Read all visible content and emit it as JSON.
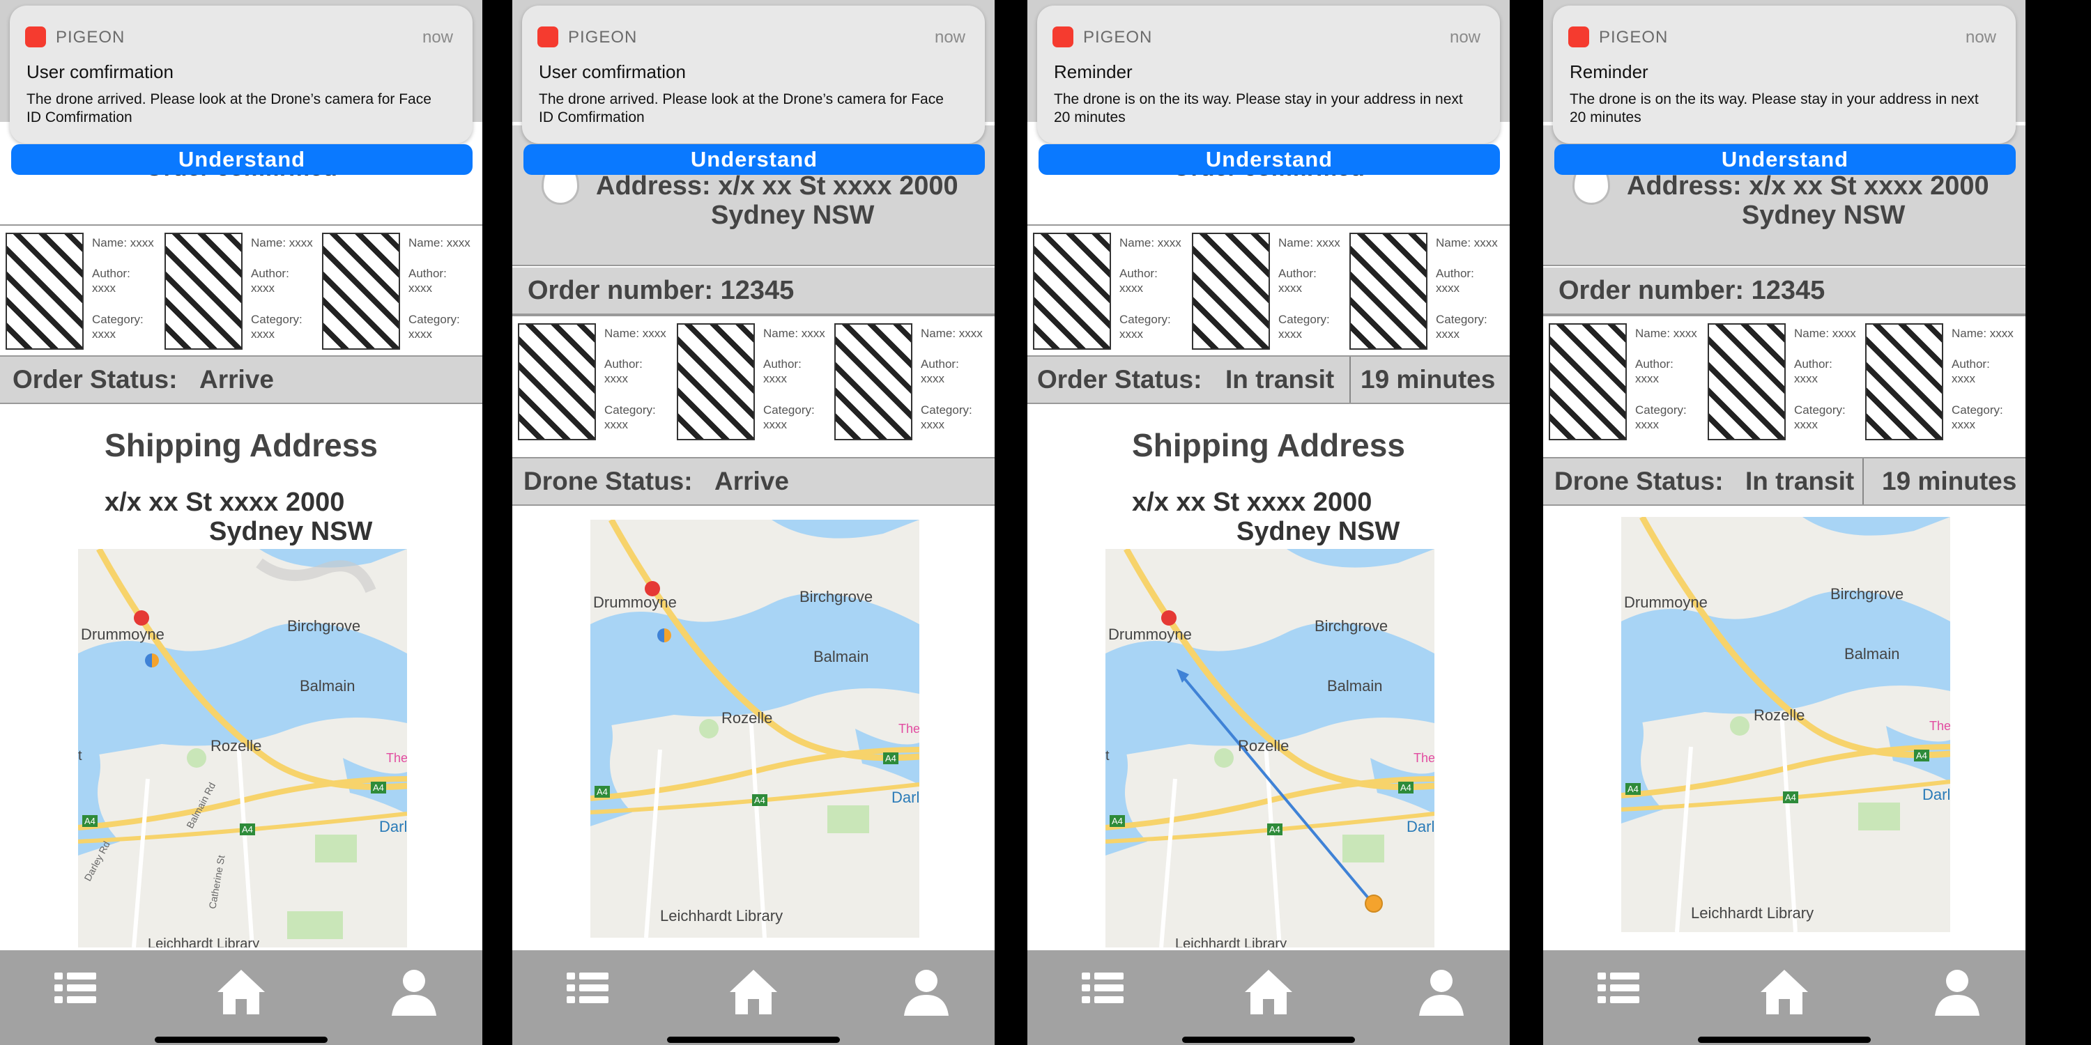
{
  "screens": [
    {
      "notification": {
        "app": "PIGEON",
        "time": "now",
        "title": "User comfirmation",
        "body": "The drone arrived. Please look at the Drone’s camera for Face ID Comfirmation",
        "button": "Understand"
      },
      "peek_title": "Order comfirmed",
      "products": [
        {
          "name": "Name: xxxx",
          "author": "Author:",
          "author_val": "xxxx",
          "category": "Category:",
          "category_val": "xxxx"
        },
        {
          "name": "Name: xxxx",
          "author": "Author:",
          "author_val": "xxxx",
          "category": "Category:",
          "category_val": "xxxx"
        },
        {
          "name": "Name: xxxx",
          "author": "Author:",
          "author_val": "xxxx",
          "category": "Category:",
          "category_val": "xxxx"
        }
      ],
      "status": {
        "label": "Order Status:",
        "value": "Arrive"
      },
      "shipping": {
        "title": "Shipping Address",
        "line1": "x/x xx St xxxx 2000",
        "line2": "Sydney NSW"
      }
    },
    {
      "notification": {
        "app": "PIGEON",
        "time": "now",
        "title": "User comfirmation",
        "body": "The drone arrived. Please look at the Drone’s camera for Face ID Comfirmation",
        "button": "Understand"
      },
      "address": {
        "line1": "Address: x/x xx St xxxx 2000",
        "line2": "Sydney NSW"
      },
      "order_number": "Order number: 12345",
      "products": [
        {
          "name": "Name: xxxx",
          "author": "Author:",
          "author_val": "xxxx",
          "category": "Category:",
          "category_val": "xxxx"
        },
        {
          "name": "Name: xxxx",
          "author": "Author:",
          "author_val": "xxxx",
          "category": "Category:",
          "category_val": "xxxx"
        },
        {
          "name": "Name: xxxx",
          "author": "Author:",
          "author_val": "xxxx",
          "category": "Category:",
          "category_val": "xxxx"
        }
      ],
      "status": {
        "label": "Drone Status:",
        "value": "Arrive"
      }
    },
    {
      "notification": {
        "app": "PIGEON",
        "time": "now",
        "title": "Reminder",
        "body": "The drone is on the its way. Please stay in your address in next 20 minutes",
        "button": "Understand"
      },
      "peek_title": "Order comfirmed",
      "products": [
        {
          "name": "Name: xxxx",
          "author": "Author:",
          "author_val": "xxxx",
          "category": "Category:",
          "category_val": "xxxx"
        },
        {
          "name": "Name: xxxx",
          "author": "Author:",
          "author_val": "xxxx",
          "category": "Category:",
          "category_val": "xxxx"
        },
        {
          "name": "Name: xxxx",
          "author": "Author:",
          "author_val": "xxxx",
          "category": "Category:",
          "category_val": "xxxx"
        }
      ],
      "status": {
        "label": "Order Status:",
        "value": "In transit",
        "eta": "19 minutes"
      },
      "shipping": {
        "title": "Shipping Address",
        "line1": "x/x xx St xxxx 2000",
        "line2": "Sydney NSW"
      }
    },
    {
      "notification": {
        "app": "PIGEON",
        "time": "now",
        "title": "Reminder",
        "body": "The drone is on the its way. Please stay in your address in next 20 minutes",
        "button": "Understand"
      },
      "address": {
        "line1": "Address: x/x xx St xxxx 2000",
        "line2": "Sydney NSW"
      },
      "order_number": "Order number: 12345",
      "products": [
        {
          "name": "Name: xxxx",
          "author": "Author:",
          "author_val": "xxxx",
          "category": "Category:",
          "category_val": "xxxx"
        },
        {
          "name": "Name: xxxx",
          "author": "Author:",
          "author_val": "xxxx",
          "category": "Category:",
          "category_val": "xxxx"
        },
        {
          "name": "Name: xxxx",
          "author": "Author:",
          "author_val": "xxxx",
          "category": "Category:",
          "category_val": "xxxx"
        }
      ],
      "status": {
        "label": "Drone Status:",
        "value": "In transit",
        "eta": "19 minutes"
      }
    }
  ],
  "map_labels": {
    "drummoyne": "Drummoyne",
    "birchgrove": "Birchgrove",
    "balmain": "Balmain",
    "rozelle": "Rozelle",
    "darl": "Darl",
    "the": "The",
    "library": "Leichhardt Library",
    "a4": "A4",
    "balmain_rd": "Balmain Rd",
    "darley_rd": "Darley Rd",
    "catherine_st": "Catherine St",
    "t": "t"
  },
  "nav": {
    "icons": [
      "list-icon",
      "home-icon",
      "profile-icon"
    ]
  },
  "colors": {
    "accent": "#0a79ff",
    "app_icon": "#f53b2f",
    "water": "#a8d4f5",
    "road": "#f7d36b",
    "park": "#c9e6b8",
    "route": "#3f82d6",
    "drone_dot": "#f4a32d",
    "pin": "#e53935"
  }
}
